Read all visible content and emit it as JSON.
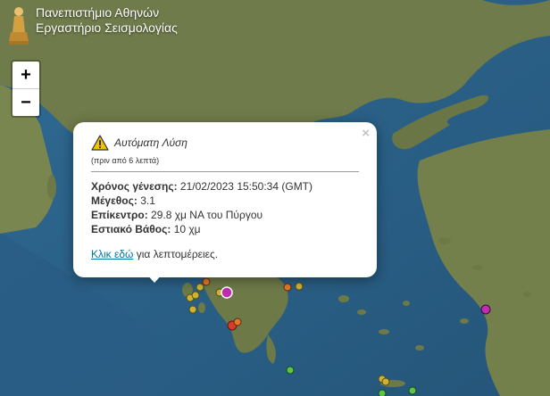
{
  "header": {
    "line1": "Πανεπιστήμιο Αθηνών",
    "line2": "Εργαστήριο Σεισμολογίας"
  },
  "zoom": {
    "in_label": "+",
    "out_label": "−"
  },
  "popup": {
    "title": "Αυτόματη Λύση",
    "subtitle": "(πριν από 6 λεπτά)",
    "close_label": "×",
    "fields": [
      {
        "label": "Χρόνος γένεσης:",
        "value": "21/02/2023 15:50:34 (GMT)"
      },
      {
        "label": "Μέγεθος:",
        "value": "3.1"
      },
      {
        "label": "Επίκεντρο:",
        "value": "29.8 χμ ΝΑ του Πύργου"
      },
      {
        "label": "Εστιακό Βάθος:",
        "value": "10 χμ"
      }
    ],
    "link_text": "Κλικ εδώ",
    "link_suffix": "για λεπτομέρειες."
  },
  "colors": {
    "sea": "#2b5f86",
    "land": "#6f7b4a",
    "selected_marker": "#c02cb0",
    "marker_green": "#5cc44b",
    "marker_yellow": "#c9b533",
    "marker_orange": "#e07a2a",
    "marker_red": "#d93a2a",
    "link": "#0078a8"
  }
}
